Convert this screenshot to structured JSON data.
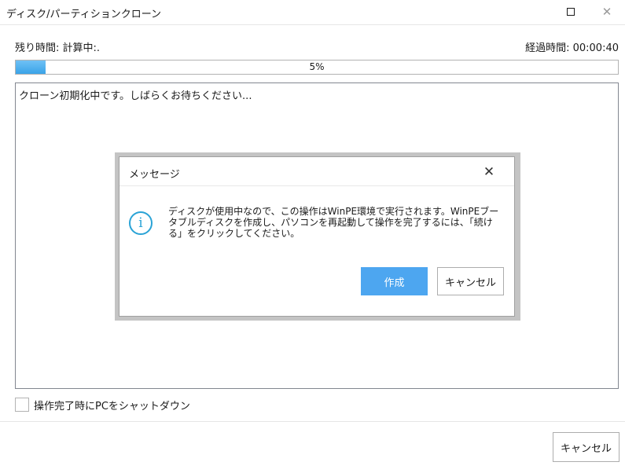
{
  "window": {
    "title": "ディスク/パーティションクローン",
    "maximize_icon": "maximize-icon",
    "close_icon": "close-icon"
  },
  "status": {
    "remaining_label": "残り時間: 計算中:.",
    "elapsed_label": "経過時間:",
    "elapsed_value": "00:00:40"
  },
  "progress": {
    "percent": 5,
    "text": "5%"
  },
  "log": {
    "lines": [
      "クローン初期化中です。しばらくお待ちください..."
    ]
  },
  "options": {
    "shutdown_label": "操作完了時にPCをシャットダウン",
    "shutdown_checked": false
  },
  "footer": {
    "cancel_label": "キャンセル"
  },
  "dialog": {
    "title": "メッセージ",
    "icon": "info-icon",
    "message": "ディスクが使用中なので、この操作はWinPE環境で実行されます。WinPEブータブルディスクを作成し、パソコンを再起動して操作を完了するには、「続ける」をクリックしてください。",
    "create_label": "作成",
    "cancel_label": "キャンセル"
  },
  "colors": {
    "accent": "#4da6f0",
    "progress": "#3aa3e8",
    "info": "#2aa3d6"
  }
}
